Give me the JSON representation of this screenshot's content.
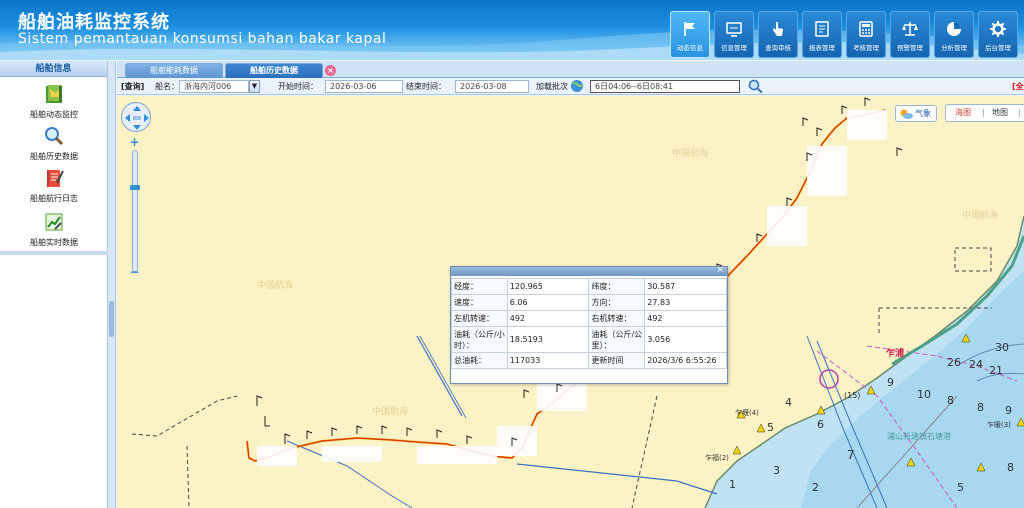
{
  "app": {
    "title_cn": "船舶油耗监控系统",
    "title_en": "Sistem pemantauan konsumsi bahan bakar kapal"
  },
  "nav": [
    {
      "label": "动态信息",
      "icon": "flag-icon",
      "active": true
    },
    {
      "label": "信息管理",
      "icon": "monitor-icon",
      "active": false
    },
    {
      "label": "查询审核",
      "icon": "hand-pointer-icon",
      "active": false
    },
    {
      "label": "报表管理",
      "icon": "report-icon",
      "active": false
    },
    {
      "label": "考核管理",
      "icon": "calculator-icon",
      "active": false
    },
    {
      "label": "预警管理",
      "icon": "scale-icon",
      "active": false
    },
    {
      "label": "分析管理",
      "icon": "chart-disc-icon",
      "active": false
    },
    {
      "label": "后台管理",
      "icon": "gear-icon",
      "active": false
    }
  ],
  "sidebar": {
    "title": "船舶信息",
    "items": [
      {
        "label": "船舶动态监控",
        "icon": "book-map-icon"
      },
      {
        "label": "船舶历史数据",
        "icon": "magnifier-icon"
      },
      {
        "label": "船舶航行日志",
        "icon": "notebook-pen-icon"
      },
      {
        "label": "船舶实时数据",
        "icon": "chart-sheet-icon"
      }
    ]
  },
  "tabs": [
    {
      "label": "船舶能耗数据",
      "active": false
    },
    {
      "label": "船舶历史数据",
      "active": true,
      "close": "×"
    }
  ],
  "query": {
    "section_label": "[查询]",
    "ship_label": "船名：",
    "ship_value": "浙海内河006",
    "dropdown_glyph": "▼",
    "start_label": "开始时间：",
    "start_value": "2026-03-06",
    "end_label": "结束时间：",
    "end_value": "2026-03-08",
    "load_label": "加载批次",
    "batch_value": "6日04:06--6日08:41",
    "corner_text": "[全"
  },
  "map": {
    "weather_label": "气象",
    "switch": {
      "sea": "海图",
      "sep": "|",
      "land": "地图",
      "end": "|"
    },
    "labels": {
      "place": "乍浦",
      "place2": "浦山新建镇石塘港",
      "place3": "乍堰(4)",
      "place4": "乍暖(3)",
      "place5": "乍福(2)",
      "place6": "(15)"
    },
    "depths": [
      "30",
      "21",
      "7",
      "8",
      "9",
      "6",
      "5",
      "4",
      "3",
      "2",
      "1",
      "10",
      "24",
      "26",
      "8",
      "9",
      "8",
      "5"
    ],
    "watermark": "中国航海"
  },
  "popup": {
    "close": "×",
    "rows": [
      {
        "k1": "经度：",
        "v1": "120.965",
        "k2": "纬度：",
        "v2": "30.587"
      },
      {
        "k1": "速度：",
        "v1": "6.06",
        "k2": "方向：",
        "v2": "27.83"
      },
      {
        "k1": "左机转速：",
        "v1": "492",
        "k2": "右机转速：",
        "v2": "492"
      },
      {
        "k1": "油耗（公斤/小时）：",
        "v1": "18.5193",
        "k2": "油耗（公斤/公里）：",
        "v2": "3.056"
      },
      {
        "k1": "总油耗：",
        "v1": "117033",
        "k2": "更新时间",
        "v2": "2026/3/6 6:55:26"
      }
    ]
  },
  "colors": {
    "header_blue": "#1c8fe0",
    "track": "#e58a00",
    "sea": "#bfe3f5",
    "land": "#fbf3c6"
  }
}
